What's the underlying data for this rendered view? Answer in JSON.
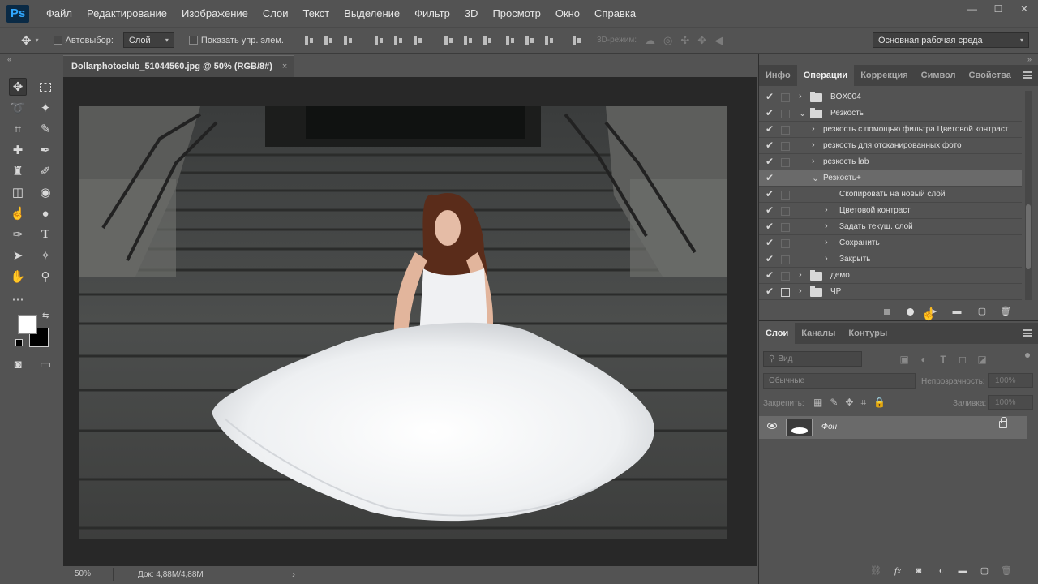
{
  "app": {
    "logo": "Ps"
  },
  "menu": [
    "Файл",
    "Редактирование",
    "Изображение",
    "Слои",
    "Текст",
    "Выделение",
    "Фильтр",
    "3D",
    "Просмотр",
    "Окно",
    "Справка"
  ],
  "window_controls": {
    "minimize": "—",
    "maximize": "☐",
    "close": "✕"
  },
  "options_bar": {
    "autoselect_label": "Автовыбор:",
    "autoselect_value": "Слой",
    "show_controls_label": "Показать упр. элем.",
    "mode_3d_label": "3D-режим:",
    "workspace": "Основная рабочая среда"
  },
  "document": {
    "tab_title": "Dollarphotoclub_51044560.jpg @ 50% (RGB/8#)",
    "tab_close": "×",
    "zoom": "50%",
    "doc_info": "Док: 4,88M/4,88M",
    "status_arrow": "›"
  },
  "top_panel": {
    "tabs": [
      "Инфо",
      "Операции",
      "Коррекция",
      "Символ",
      "Свойства"
    ],
    "active_tab": 1
  },
  "actions": [
    {
      "label": "BOX004",
      "level": 0,
      "kind": "set",
      "expanded": false,
      "checked": true,
      "dialog": false
    },
    {
      "label": "Резкость",
      "level": 0,
      "kind": "set",
      "expanded": true,
      "checked": true,
      "dialog": false
    },
    {
      "label": "резкость с помощью фильтра Цветовой контраст",
      "level": 1,
      "kind": "action",
      "expanded": false,
      "checked": true,
      "dialog": false
    },
    {
      "label": "резкость для отсканированных фото",
      "level": 1,
      "kind": "action",
      "expanded": false,
      "checked": true,
      "dialog": false
    },
    {
      "label": "резкость lab",
      "level": 1,
      "kind": "action",
      "expanded": false,
      "checked": true,
      "dialog": false
    },
    {
      "label": "Резкость+",
      "level": 1,
      "kind": "action",
      "expanded": true,
      "checked": true,
      "dialog": false,
      "selected": true
    },
    {
      "label": "Скопировать на новый слой",
      "level": 2,
      "kind": "step",
      "expanded": false,
      "checked": true,
      "dialog": false,
      "no_disclosure": true
    },
    {
      "label": "Цветовой контраст",
      "level": 2,
      "kind": "step",
      "expanded": false,
      "checked": true,
      "dialog": false
    },
    {
      "label": "Задать текущ. слой",
      "level": 2,
      "kind": "step",
      "expanded": false,
      "checked": true,
      "dialog": false
    },
    {
      "label": "Сохранить",
      "level": 2,
      "kind": "step",
      "expanded": false,
      "checked": true,
      "dialog": false
    },
    {
      "label": "Закрыть",
      "level": 2,
      "kind": "step",
      "expanded": false,
      "checked": true,
      "dialog": false
    },
    {
      "label": "демо",
      "level": 0,
      "kind": "set",
      "expanded": false,
      "checked": true,
      "dialog": false
    },
    {
      "label": "ЧР",
      "level": 0,
      "kind": "set",
      "expanded": false,
      "checked": true,
      "dialog": true
    }
  ],
  "layers_panel": {
    "tabs": [
      "Слои",
      "Каналы",
      "Контуры"
    ],
    "active_tab": 0,
    "search_placeholder": "Вид",
    "blend_mode": "Обычные",
    "opacity_label": "Непрозрачность:",
    "opacity_value": "100%",
    "lock_label": "Закрепить:",
    "fill_label": "Заливка:",
    "fill_value": "100%",
    "layers": [
      {
        "name": "Фон",
        "visible": true,
        "locked": true
      }
    ]
  },
  "colors": {
    "ui_bg": "#535353",
    "canvas_bg": "#282828",
    "selected_row": "#6a6a6a"
  }
}
